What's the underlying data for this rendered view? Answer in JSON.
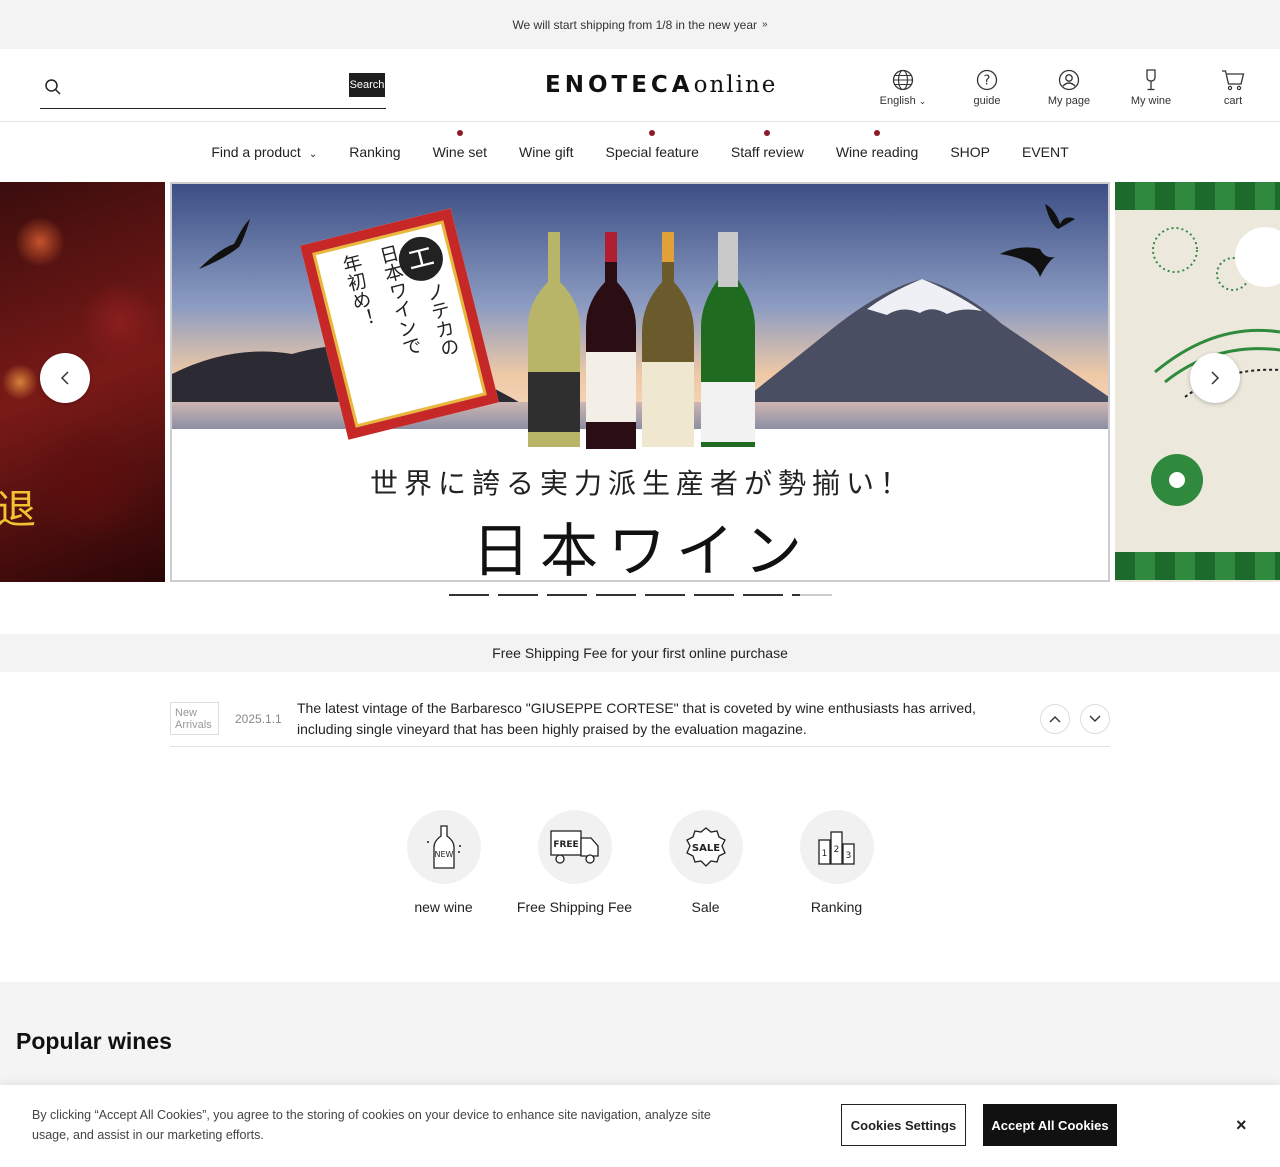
{
  "announcement": {
    "text": "We will start shipping from 1/8 in the new year",
    "arrow": "»"
  },
  "header": {
    "search_placeholder": "",
    "search_button": "Search",
    "logo_main": "ENOTECA",
    "logo_sub": "online",
    "icons": [
      {
        "label": "English",
        "icon": "globe-icon"
      },
      {
        "label": "guide",
        "icon": "help-icon"
      },
      {
        "label": "My page",
        "icon": "user-icon"
      },
      {
        "label": "My wine",
        "icon": "wine-glass-icon"
      },
      {
        "label": "cart",
        "icon": "cart-icon"
      }
    ]
  },
  "nav": [
    {
      "label": "Find a product",
      "dot": false,
      "dropdown": true
    },
    {
      "label": "Ranking",
      "dot": false
    },
    {
      "label": "Wine set",
      "dot": true
    },
    {
      "label": "Wine gift",
      "dot": false
    },
    {
      "label": "Special feature",
      "dot": true
    },
    {
      "label": "Staff review",
      "dot": true
    },
    {
      "label": "Wine reading",
      "dot": true
    },
    {
      "label": "SHOP",
      "dot": false
    },
    {
      "label": "EVENT",
      "dot": false
    }
  ],
  "banner": {
    "card_circle": "エ",
    "card_col1": "ノテカの",
    "card_col2": "日本ワインで",
    "card_col3": "年初め！",
    "tagline": "世界に誇る実力派生産者が勢揃い！",
    "title": "日本ワイン",
    "left_slide_char": "退"
  },
  "carousel_dots": 8,
  "promo": {
    "text": "Free Shipping Fee for your first online purchase"
  },
  "news": {
    "badge_line1": "New",
    "badge_line2": "Arrivals",
    "date": "2025.1.1",
    "text": "The latest vintage of the Barbaresco \"GIUSEPPE CORTESE\" that is coveted by wine enthusiasts has arrived, including single vineyard that has been highly praised by the evaluation magazine."
  },
  "quick_links": [
    {
      "label": "new wine",
      "icon": "new-wine-icon",
      "icon_text": "NEW"
    },
    {
      "label": "Free Shipping Fee",
      "icon": "free-shipping-truck-icon",
      "icon_text": "FREE"
    },
    {
      "label": "Sale",
      "icon": "sale-badge-icon",
      "icon_text": "SALE"
    },
    {
      "label": "Ranking",
      "icon": "ranking-podium-icon",
      "icon_text": ""
    }
  ],
  "popular": {
    "title": "Popular wines"
  },
  "cookie": {
    "text": "By clicking “Accept All Cookies”, you agree to the storing of cookies on your device to enhance site navigation, analyze site usage, and assist in our marketing efforts.",
    "settings": "Cookies Settings",
    "accept": "Accept All Cookies",
    "close": "×"
  },
  "colors": {
    "accent_dot": "#8b1a2b",
    "dark": "#111111",
    "promo_bg": "#f3f3f3"
  }
}
